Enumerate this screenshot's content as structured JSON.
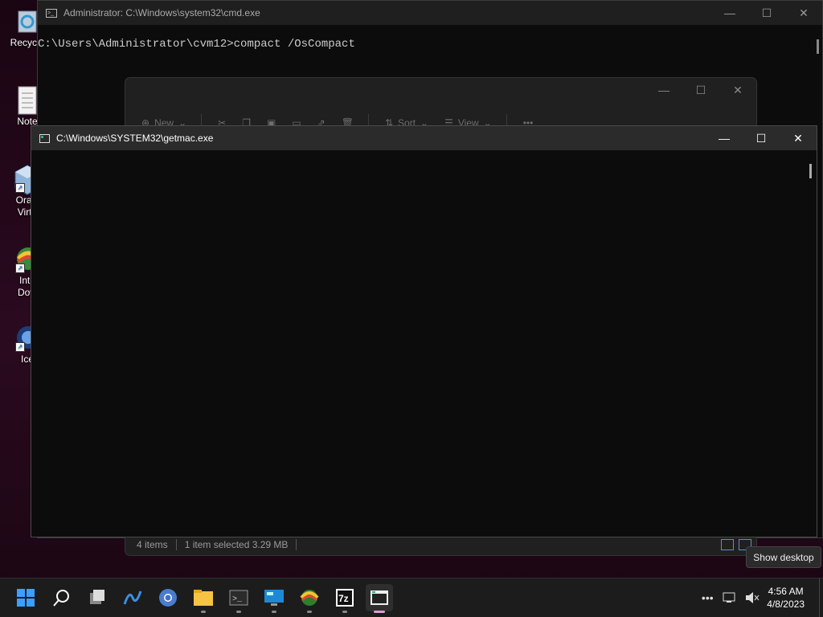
{
  "desktop": {
    "icons": [
      {
        "label": "Recycle",
        "icon": "recycle-bin-icon"
      },
      {
        "label": "Note",
        "icon": "notepad-icon"
      },
      {
        "label": "Oracl",
        "label2": "Virtu",
        "icon": "virtualbox-icon"
      },
      {
        "label": "Inte",
        "label2": "Dow",
        "icon": "internet-download-manager-icon"
      },
      {
        "label": "Ice",
        "icon": "icecream-icon"
      }
    ]
  },
  "cmd_window": {
    "title": "Administrator:  C:\\Windows\\system32\\cmd.exe",
    "line": "C:\\Users\\Administrator\\cvm12>compact /OsCompact"
  },
  "explorer_window": {
    "toolbar": {
      "new_label": "New",
      "sort_label": "Sort",
      "view_label": "View"
    },
    "status": {
      "items": "4 items",
      "selected": "1 item selected  3.29 MB"
    }
  },
  "getmac_window": {
    "title": "C:\\Windows\\SYSTEM32\\getmac.exe"
  },
  "tooltip": {
    "text": "Show desktop"
  },
  "taskbar": {
    "apps": [
      "start-icon",
      "search-icon",
      "task-view-icon",
      "wireshark-icon",
      "chrome-icon",
      "file-explorer-icon",
      "terminal-icon",
      "remote-desktop-icon",
      "idm-icon",
      "7zip-icon",
      "console-app-icon"
    ],
    "time": "4:56 AM",
    "date": "4/8/2023"
  }
}
